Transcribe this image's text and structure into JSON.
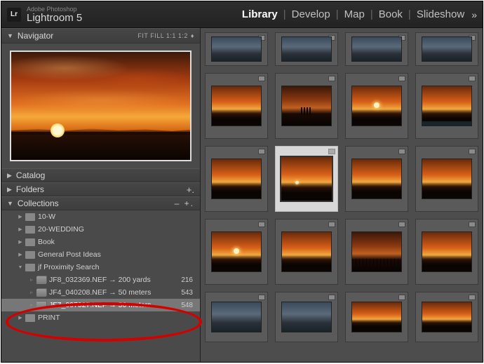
{
  "brand": {
    "logo": "Lr",
    "small": "Adobe Photoshop",
    "big": "Lightroom 5"
  },
  "modules": {
    "library": "Library",
    "develop": "Develop",
    "map": "Map",
    "book": "Book",
    "slideshow": "Slideshow"
  },
  "navigator": {
    "title": "Navigator",
    "zoom": "FIT  FILL  1:1  1:2"
  },
  "catalog": {
    "title": "Catalog"
  },
  "folders": {
    "title": "Folders"
  },
  "collections": {
    "title": "Collections",
    "items": [
      {
        "label": "10-W"
      },
      {
        "label": "20-WEDDING"
      },
      {
        "label": "Book"
      },
      {
        "label": "General Post Ideas"
      },
      {
        "label": "jf Proximity Search"
      }
    ],
    "sub": [
      {
        "label": "JF8_032369.NEF → 200 yards",
        "count": "216"
      },
      {
        "label": "JF4_040208.NEF → 50 meters",
        "count": "543"
      },
      {
        "label": "JF7_007027.NEF → 50 meters",
        "count": "548"
      }
    ],
    "print": "PRINT"
  }
}
